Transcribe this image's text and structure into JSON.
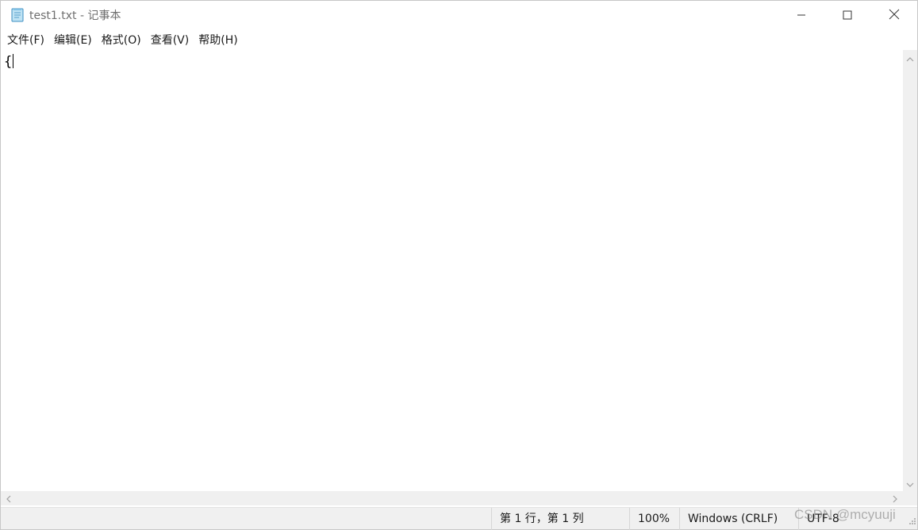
{
  "window": {
    "title": "test1.txt - 记事本"
  },
  "icons": {
    "app": "notepad-icon",
    "minimize": "minimize-icon",
    "maximize": "maximize-icon",
    "close": "close-icon",
    "scroll_up": "chevron-up-icon",
    "scroll_down": "chevron-down-icon",
    "scroll_left": "chevron-left-icon",
    "scroll_right": "chevron-right-icon",
    "resize": "resize-grip-icon"
  },
  "menu": {
    "items": [
      {
        "label": "文件(F)"
      },
      {
        "label": "编辑(E)"
      },
      {
        "label": "格式(O)"
      },
      {
        "label": "查看(V)"
      },
      {
        "label": "帮助(H)"
      }
    ]
  },
  "editor": {
    "content": "{"
  },
  "status": {
    "position": "第 1 行，第 1 列",
    "zoom": "100%",
    "line_ending": "Windows (CRLF)",
    "encoding": "UTF-8"
  },
  "watermark": "CSDN @mcyuuji",
  "colors": {
    "chrome_bg": "#f0f0f0",
    "title_text": "#6e6e6e",
    "editor_bg": "#ffffff"
  }
}
